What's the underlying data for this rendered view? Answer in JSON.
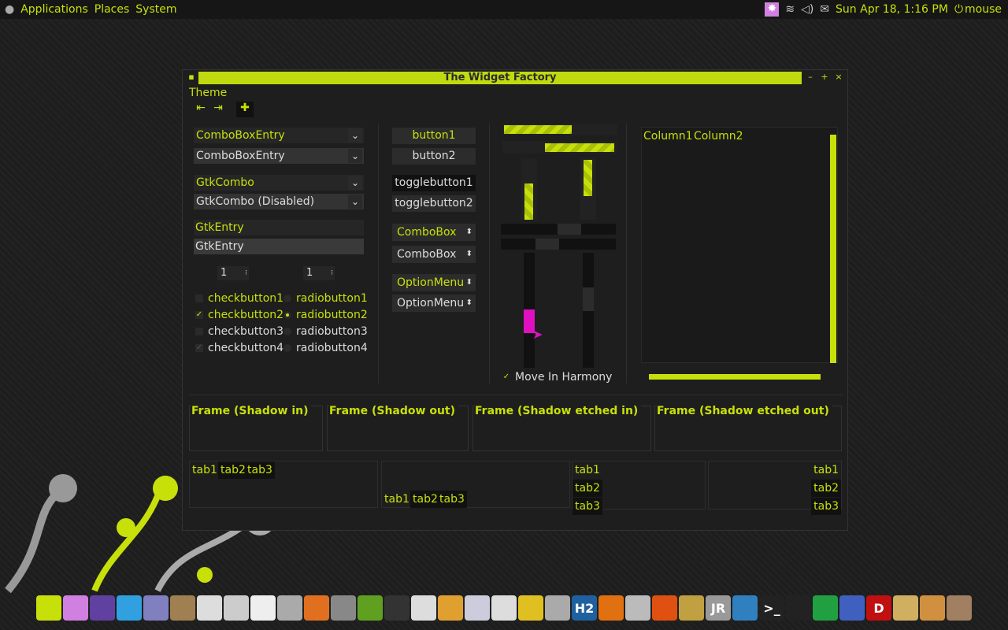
{
  "topbar": {
    "menu_applications": "Applications",
    "menu_places": "Places",
    "menu_system": "System",
    "clock": "Sun Apr 18,  1:16 PM",
    "user": "mouse"
  },
  "window": {
    "title": "The Widget Factory",
    "menu_theme": "Theme"
  },
  "left": {
    "combo1": "ComboBoxEntry",
    "combo2": "ComboBoxEntry",
    "gtkcombo1": "GtkCombo",
    "gtkcombo2": "GtkCombo (Disabled)",
    "entry1": "GtkEntry",
    "entry2": "GtkEntry",
    "spin1": "1",
    "spin2": "1",
    "checks": [
      "checkbutton1",
      "checkbutton2",
      "checkbutton3",
      "checkbutton4"
    ],
    "radios": [
      "radiobutton1",
      "radiobutton2",
      "radiobutton3",
      "radiobutton4"
    ]
  },
  "middle": {
    "button1": "button1",
    "button2": "button2",
    "toggle1": "togglebutton1",
    "toggle2": "togglebutton2",
    "combobox1": "ComboBox",
    "combobox2": "ComboBox",
    "option1": "OptionMenu",
    "option2": "OptionMenu"
  },
  "sliders": {
    "harmony": "Move In Harmony",
    "hprogress1": 0.6,
    "hprogress2": 0.6,
    "vprogress1": 0.6,
    "vprogress2": 0.6
  },
  "tree": {
    "col1": "Column1",
    "col2": "Column2"
  },
  "frames": [
    "Frame (Shadow in)",
    "Frame (Shadow out)",
    "Frame (Shadow etched in)",
    "Frame (Shadow etched out)"
  ],
  "tabs": {
    "t1": "tab1",
    "t2": "tab2",
    "t3": "tab3"
  },
  "colors": {
    "accent": "#c8e00a",
    "slider": "#e010c0"
  },
  "dock_icons": [
    "anchor-icon",
    "flower-icon",
    "globe-icon",
    "skype-icon",
    "pidgin-icon",
    "film-icon",
    "mail-icon",
    "weather-icon",
    "scanner-icon",
    "aperture-icon",
    "blender-icon",
    "gimp-icon",
    "plant-icon",
    "inkscape-icon",
    "doc-icon",
    "chart-icon",
    "doc2-icon",
    "text-icon",
    "notes-icon",
    "disk-icon",
    "h2-icon",
    "vlc-icon",
    "ipod-icon",
    "fire-icon",
    "brush-icon",
    "jr-icon",
    "monitor-icon",
    "terminal-icon",
    "sysmon-icon",
    "windows-icon",
    "ball-icon",
    "d-icon",
    "folder-down-icon",
    "folder-up-icon",
    "archive-icon"
  ]
}
